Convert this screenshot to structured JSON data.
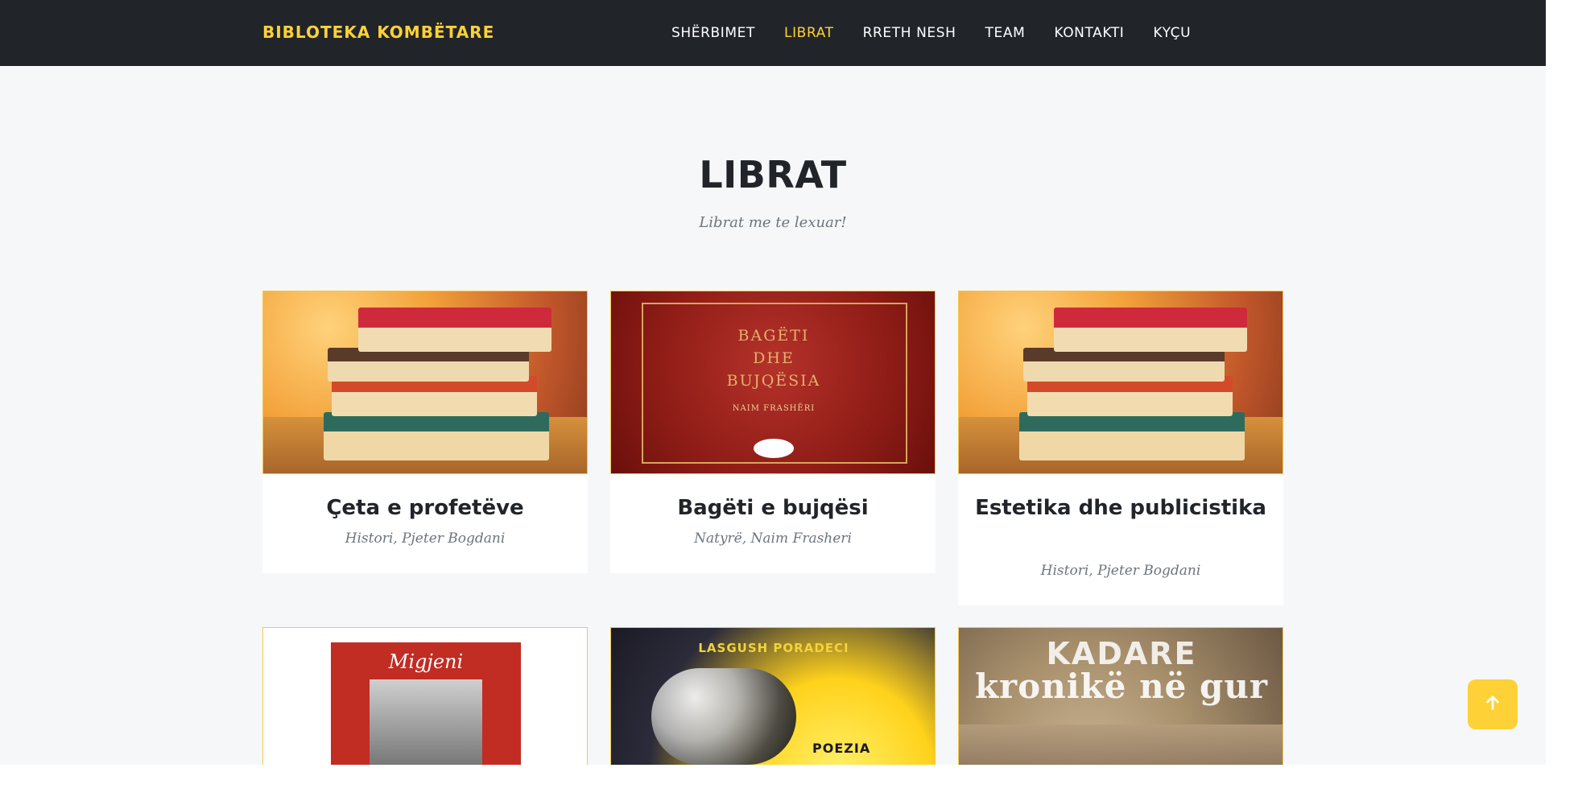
{
  "brand": "BIBLOTEKA KOMBËTARE",
  "nav": {
    "items": [
      {
        "label": "SHËRBIMET",
        "active": false
      },
      {
        "label": "LIBRAT",
        "active": true
      },
      {
        "label": "RRETH NESH",
        "active": false
      },
      {
        "label": "TEAM",
        "active": false
      },
      {
        "label": "KONTAKTI",
        "active": false
      },
      {
        "label": "KYÇU",
        "active": false
      }
    ]
  },
  "section": {
    "title": "LIBRAT",
    "subtitle": "Librat me te lexuar!"
  },
  "books": [
    {
      "title": "Çeta e profetëve",
      "meta": "Histori, Pjeter Bogdani",
      "cover": "stack-of-books"
    },
    {
      "title": "Bagëti e bujqësi",
      "meta": "Natyrë, Naim Frasheri",
      "cover": "red-book-cover",
      "cover_text": {
        "line1": "BAGËTI",
        "line2": "DHE",
        "line3": "BUJQËSIA",
        "author": "NAIM FRASHËRI"
      }
    },
    {
      "title": "Estetika dhe publicistika",
      "meta": "Histori, Pjeter Bogdani",
      "cover": "stack-of-books"
    },
    {
      "title": "",
      "meta": "",
      "cover": "migjeni-cover",
      "cover_text": {
        "name": "Migjeni"
      }
    },
    {
      "title": "",
      "meta": "",
      "cover": "lasgush-cover",
      "cover_text": {
        "author": "LASGUSH PORADECI",
        "label": "POEZIA"
      }
    },
    {
      "title": "",
      "meta": "",
      "cover": "kadare-cover",
      "cover_text": {
        "author": "KADARE",
        "title": "kronikë në gur"
      }
    }
  ],
  "colors": {
    "navbar": "#212529",
    "accent": "#fed136",
    "page_bg": "#f6f7f9",
    "text": "#212529",
    "muted": "#6c757d"
  },
  "icons": {
    "to_top": "arrow-up-icon"
  }
}
